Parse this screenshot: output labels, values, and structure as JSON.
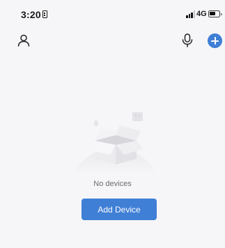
{
  "status_bar": {
    "time": "3:20",
    "network": "4G"
  },
  "icons": {
    "profile": "user-icon",
    "voice": "microphone-icon",
    "add": "plus-circle-icon",
    "illustration": "empty-box-icon"
  },
  "empty_state": {
    "message": "No devices",
    "button_label": "Add Device"
  },
  "colors": {
    "accent": "#3f7fd6",
    "background": "#f6f6f8"
  }
}
